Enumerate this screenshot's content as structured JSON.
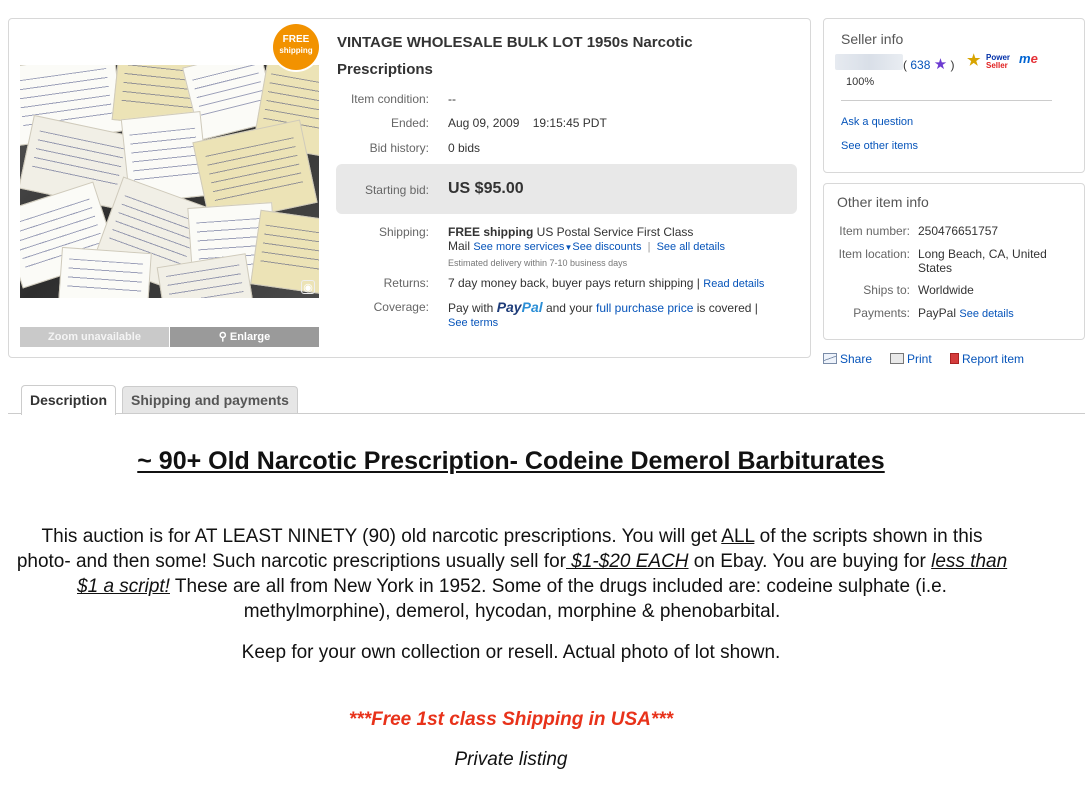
{
  "item": {
    "badge_line1": "FREE",
    "badge_line2": "shipping",
    "title": "VINTAGE WHOLESALE BULK LOT 1950s Narcotic Prescriptions",
    "zoom_label": "Zoom unavailable",
    "enlarge_label": "Enlarge",
    "condition_label": "Item condition:",
    "condition_value": "--",
    "ended_label": "Ended:",
    "ended_value": "Aug 09, 2009    19:15:45 PDT",
    "bid_history_label": "Bid history:",
    "bid_history_value": "0 bids",
    "starting_bid_label": "Starting bid:",
    "starting_bid_value": "US $95.00",
    "shipping_label": "Shipping:",
    "shipping_free": "FREE shipping",
    "shipping_service": " US Postal Service First Class",
    "shipping_mail": "Mail ",
    "see_more_services": "See more services",
    "see_discounts": "See discounts",
    "pipe": "  |  ",
    "see_all_details": "See all details",
    "delivery_estimate": "Estimated delivery within 7-10 business days",
    "returns_label": "Returns:",
    "returns_value": "7 day money back, buyer pays return shipping | ",
    "read_details": "Read details",
    "coverage_label": "Coverage:",
    "pay_with": "Pay with ",
    "paypal_pay": "Pay",
    "paypal_pal": "Pal",
    "and_your": " and your ",
    "full_purchase_price": "full purchase price",
    "is_covered": " is covered |",
    "see_terms": "See terms"
  },
  "seller": {
    "panel_title": "Seller info",
    "score_open": "( ",
    "feedback_score": "638",
    "score_close": " )",
    "power_seller_line1": "Power",
    "power_seller_line2": "Seller",
    "me_badge_m": "m",
    "me_badge_e": "e",
    "feedback_percent": "100%",
    "ask_question": "Ask a question",
    "see_other_items": "See other items"
  },
  "other_info": {
    "panel_title": "Other item info",
    "item_number_label": "Item number:",
    "item_number_value": "250476651757",
    "location_label": "Item location:",
    "location_value": "Long Beach, CA, United States",
    "ships_to_label": "Ships to:",
    "ships_to_value": "Worldwide",
    "payments_label": "Payments:",
    "payments_value": "PayPal ",
    "see_details": "See details"
  },
  "share_bar": {
    "share": "Share",
    "print": "Print",
    "report": "Report item"
  },
  "tabs": {
    "description": "Description",
    "shipping_payments": "Shipping and payments"
  },
  "description": {
    "heading": "~ 90+ Old Narcotic Prescription- Codeine Demerol Barbiturates",
    "p1_a": "This auction is for AT LEAST NINETY (90) old narcotic prescriptions. You will get ",
    "p1_all": "ALL",
    "p1_b": " of the scripts shown in this photo- and then some!  Such narcotic prescriptions usually sell for",
    "p1_price": " $1-$20 EACH",
    "p1_c": " on Ebay. You are buying for ",
    "p1_less": "less than $1 a script!",
    "p1_d": " These are all from New York in 1952. Some of the drugs included are: codeine sulphate (i.e. methylmorphine), demerol, hycodan, morphine & phenobarbital.",
    "p2": "Keep for your own collection or resell. Actual photo of lot shown.",
    "p3": "***Free 1st class Shipping in USA***",
    "p4": "Private listing"
  },
  "colors": {
    "link": "#0654ba",
    "badge_orange": "#f29200",
    "free_shipping_red": "#e8321a"
  }
}
